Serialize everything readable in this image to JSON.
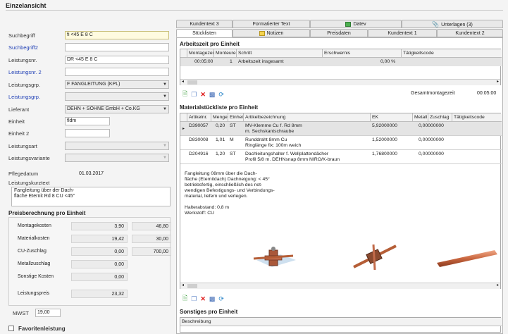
{
  "title": "Einzelansicht",
  "left": {
    "suchbegriff_label": "Suchbegriff",
    "suchbegriff_value": "fi <45 E 8 C",
    "suchbegriff2_label": "Suchbegriff2",
    "suchbegriff2_value": "",
    "leistungsnr_label": "Leistungsnr.",
    "leistungsnr_value": "DR <45 E 8 C",
    "leistungsnr2_label": "Leistungsnr. 2",
    "leistungsnr2_value": "",
    "leistungsgrp_label": "Leistungsgrp.",
    "leistungsgrp_value": "F FANGLEITUNG (KPL)",
    "leistungsgrp2_label": "Leistungsgrp.",
    "leistungsgrp2_value": "",
    "lieferant_label": "Lieferant",
    "lieferant_value": "DEHN + SÖHNE GmbH + Co.KG",
    "einheit_label": "Einheit",
    "einheit_value": "fldm",
    "einheit2_label": "Einheit 2",
    "einheit2_value": "",
    "leistungsart_label": "Leistungsart",
    "leistungsart_value": "",
    "leistungsvariante_label": "Leistungsvariante",
    "leistungsvariante_value": "",
    "pflegedatum_label": "Pflegedatum",
    "pflegedatum_value": "01.03.2017",
    "kurztext_label": "Leistungskurztext",
    "kurztext_line1": "Fangleitung über der Dach-",
    "kurztext_line2": "fläche Eternit Rd 8 CU <45°"
  },
  "preis": {
    "heading": "Preisberechnung pro Einheit",
    "rows": [
      {
        "label": "Montagekosten",
        "v1": "3,90",
        "v2": "46,80"
      },
      {
        "label": "Materialkosten",
        "v1": "19,42",
        "v2": "30,00"
      },
      {
        "label": "CU-Zuschlag",
        "v1": "0,00",
        "v2": "700,00"
      },
      {
        "label": "Metallzuschlag",
        "v1": "0,00",
        "v2": ""
      },
      {
        "label": "Sonstige Kosten",
        "v1": "0,00",
        "v2": ""
      }
    ],
    "leistungspreis_label": "Leistungspreis",
    "leistungspreis_value": "23,32",
    "mwst_label": "MWST",
    "mwst_value": "19,00",
    "favoriten_label": "Favoritenleistung"
  },
  "tabs_top": [
    "Kundentext 3",
    "Formatierter Text",
    "Datev",
    "Unterlagen (3)"
  ],
  "tabs_bottom": [
    "Stücklisten",
    "Notizen",
    "Preisdaten",
    "Kundentext 1",
    "Kundentext 2"
  ],
  "arbeitszeit": {
    "heading": "Arbeitszeit pro Einheit",
    "columns": [
      "Montagezeit",
      "Monteure",
      "Schritt",
      "Erschwernis",
      "Tätigkeitscode"
    ],
    "row": {
      "montagezeit": "00:05:00",
      "monteure": "1",
      "schritt": "Arbeitszeit insgesamt",
      "erschwernis": "0,00 %",
      "taetigkeit": ""
    },
    "gesamt_label": "Gesamtmontagezeit",
    "gesamt_value": "00:05:00"
  },
  "material": {
    "heading": "Materialstückliste pro Einheit",
    "columns": [
      "Artikelnr.",
      "Menge",
      "Einheit",
      "Artikelbezeichnung",
      "EK",
      "Metall",
      "Zuschlag",
      "Tätigkeitscode"
    ],
    "rows": [
      {
        "nr": "D390057",
        "menge": "0,20",
        "einheit": "ST",
        "bez1": "MV-Klemme Cu f. Rd 8mm",
        "bez2": "m. Sechskantschraube",
        "ek": "5,92000000",
        "zuschlag": "0,00000000"
      },
      {
        "nr": "D830008",
        "menge": "1,01",
        "einheit": "M",
        "bez1": "Runddraht 8mm Cu",
        "bez2": "Ringlänge fix: 100m weich",
        "ek": "1,52000000",
        "zuschlag": "0,00000000"
      },
      {
        "nr": "D204916",
        "menge": "1,20",
        "einheit": "ST",
        "bez1": "Dachleitungshalter f. Wellplattendächer",
        "bez2": "Profil 5/8 m. DEHNsnap 8mm NIRO/K-braun",
        "ek": "1,76800000",
        "zuschlag": "0,00000000"
      }
    ],
    "desc_lines": [
      "Fangleitung 08mm über die Dach-",
      "fläche (Eternitdach) Dachneigung: < 45°",
      "betriebsfertig, einschließlich des not-",
      "wendigen Befestigungs- und Verbindungs-",
      "material, liefern und verlegen.",
      "",
      "Halterabstand: 0,8 m",
      "Werkstoff: CU"
    ]
  },
  "sonstiges": {
    "heading": "Sonstiges pro Einheit",
    "col": "Beschreibung"
  }
}
